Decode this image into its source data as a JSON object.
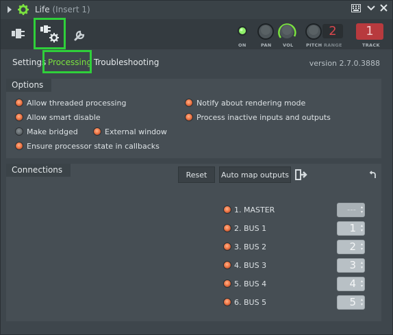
{
  "window": {
    "title": "Life",
    "subtitle": "(Insert 1)"
  },
  "titlebar_buttons": [
    "keyboard-icon",
    "chevron-down-icon",
    "close-icon"
  ],
  "toolbar": {
    "knobs": {
      "on_label": "ON",
      "pan_label": "PAN",
      "vol_label": "VOL",
      "pitch_label": "PITCH",
      "range_label": "RANGE",
      "range_value": "2",
      "track_label": "TRACK",
      "track_value": "1"
    }
  },
  "tabs": {
    "settings": "Settings",
    "processing": "Processing",
    "troubleshooting": "Troubleshooting",
    "active": "processing"
  },
  "version": "version 2.7.0.3888",
  "options": {
    "title": "Options",
    "threaded": "Allow threaded processing",
    "smart_disable": "Allow smart disable",
    "bridged": "Make bridged",
    "external_window": "External window",
    "ensure_state": "Ensure processor state in callbacks",
    "notify_render": "Notify about rendering mode",
    "process_inactive": "Process inactive inputs and outputs"
  },
  "connections": {
    "title": "Connections",
    "reset": "Reset",
    "auto_map": "Auto map outputs",
    "outputs": [
      {
        "label": "1. MASTER",
        "value": "---"
      },
      {
        "label": "2. BUS 1",
        "value": "1"
      },
      {
        "label": "3. BUS 2",
        "value": "2"
      },
      {
        "label": "4. BUS 3",
        "value": "3"
      },
      {
        "label": "5. BUS 4",
        "value": "4"
      },
      {
        "label": "6. BUS 5",
        "value": "5"
      }
    ]
  },
  "colors": {
    "highlight": "#2fd03a",
    "active_tab": "#7be33f",
    "led_on": "#f07a4a",
    "track_badge": "#b83a3e"
  }
}
